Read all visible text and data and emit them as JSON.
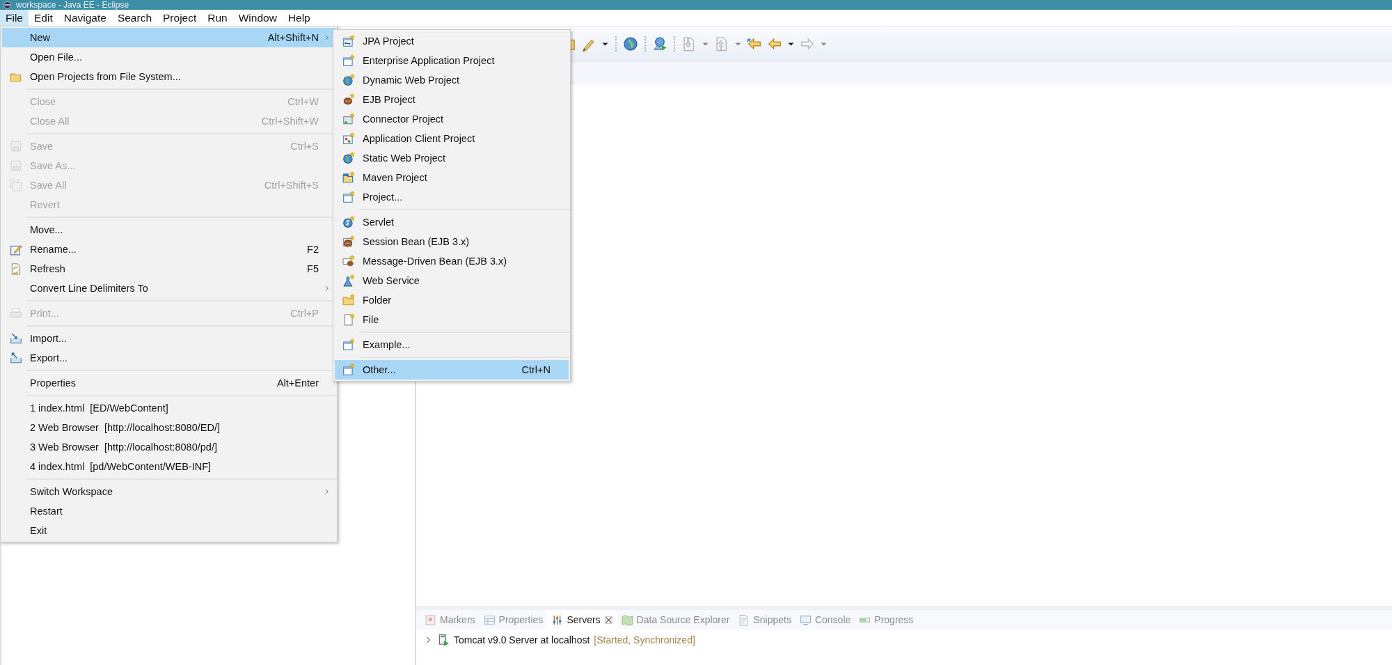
{
  "window": {
    "title": "workspace - Java EE - Eclipse"
  },
  "menu_bar": [
    {
      "label": "File",
      "selected": true
    },
    {
      "label": "Edit",
      "selected": false
    },
    {
      "label": "Navigate",
      "selected": false
    },
    {
      "label": "Search",
      "selected": false
    },
    {
      "label": "Project",
      "selected": false
    },
    {
      "label": "Run",
      "selected": false
    },
    {
      "label": "Window",
      "selected": false
    },
    {
      "label": "Help",
      "selected": false
    }
  ],
  "file_menu": {
    "items": [
      {
        "kind": "item",
        "label": "New",
        "shortcut": "Alt+Shift+N",
        "submenu": true,
        "disabled": false,
        "selected": true
      },
      {
        "kind": "item",
        "label": "Open File...",
        "submenu": false,
        "disabled": false,
        "selected": false
      },
      {
        "kind": "item",
        "label": "Open Projects from File System...",
        "submenu": false,
        "disabled": false,
        "selected": false
      },
      {
        "kind": "separator"
      },
      {
        "kind": "item",
        "label": "Close",
        "shortcut": "Ctrl+W",
        "submenu": false,
        "disabled": true,
        "selected": false
      },
      {
        "kind": "item",
        "label": "Close All",
        "shortcut": "Ctrl+Shift+W",
        "submenu": false,
        "disabled": true,
        "selected": false
      },
      {
        "kind": "separator"
      },
      {
        "kind": "item",
        "label": "Save",
        "shortcut": "Ctrl+S",
        "submenu": false,
        "disabled": true,
        "selected": false
      },
      {
        "kind": "item",
        "label": "Save As...",
        "submenu": false,
        "disabled": true,
        "selected": false
      },
      {
        "kind": "item",
        "label": "Save All",
        "shortcut": "Ctrl+Shift+S",
        "submenu": false,
        "disabled": true,
        "selected": false
      },
      {
        "kind": "item",
        "label": "Revert",
        "submenu": false,
        "disabled": true,
        "selected": false
      },
      {
        "kind": "separator"
      },
      {
        "kind": "item",
        "label": "Move...",
        "submenu": false,
        "disabled": false,
        "selected": false
      },
      {
        "kind": "item",
        "label": "Rename...",
        "shortcut": "F2",
        "submenu": false,
        "disabled": false,
        "selected": false
      },
      {
        "kind": "item",
        "label": "Refresh",
        "shortcut": "F5",
        "submenu": false,
        "disabled": false,
        "selected": false
      },
      {
        "kind": "item",
        "label": "Convert Line Delimiters To",
        "submenu": true,
        "disabled": false,
        "selected": false
      },
      {
        "kind": "separator"
      },
      {
        "kind": "item",
        "label": "Print...",
        "shortcut": "Ctrl+P",
        "submenu": false,
        "disabled": true,
        "selected": false
      },
      {
        "kind": "separator"
      },
      {
        "kind": "item",
        "label": "Import...",
        "submenu": false,
        "disabled": false,
        "selected": false
      },
      {
        "kind": "item",
        "label": "Export...",
        "submenu": false,
        "disabled": false,
        "selected": false
      },
      {
        "kind": "separator"
      },
      {
        "kind": "item",
        "label": "Properties",
        "shortcut": "Alt+Enter",
        "submenu": false,
        "disabled": false,
        "selected": false
      },
      {
        "kind": "separator"
      },
      {
        "kind": "item",
        "label": "1 index.html  [ED/WebContent]",
        "submenu": false,
        "disabled": false,
        "selected": false
      },
      {
        "kind": "item",
        "label": "2 Web Browser  [http://localhost:8080/ED/]",
        "submenu": false,
        "disabled": false,
        "selected": false
      },
      {
        "kind": "item",
        "label": "3 Web Browser  [http://localhost:8080/pd/]",
        "submenu": false,
        "disabled": false,
        "selected": false
      },
      {
        "kind": "item",
        "label": "4 index.html  [pd/WebContent/WEB-INF]",
        "submenu": false,
        "disabled": false,
        "selected": false
      },
      {
        "kind": "separator"
      },
      {
        "kind": "item",
        "label": "Switch Workspace",
        "submenu": true,
        "disabled": false,
        "selected": false
      },
      {
        "kind": "item",
        "label": "Restart",
        "submenu": false,
        "disabled": false,
        "selected": false
      },
      {
        "kind": "item",
        "label": "Exit",
        "submenu": false,
        "disabled": false,
        "selected": false
      }
    ]
  },
  "new_submenu": {
    "items": [
      {
        "kind": "item",
        "label": "JPA Project",
        "selected": false
      },
      {
        "kind": "item",
        "label": "Enterprise Application Project",
        "selected": false
      },
      {
        "kind": "item",
        "label": "Dynamic Web Project",
        "selected": false
      },
      {
        "kind": "item",
        "label": "EJB Project",
        "selected": false
      },
      {
        "kind": "item",
        "label": "Connector Project",
        "selected": false
      },
      {
        "kind": "item",
        "label": "Application Client Project",
        "selected": false
      },
      {
        "kind": "item",
        "label": "Static Web Project",
        "selected": false
      },
      {
        "kind": "item",
        "label": "Maven Project",
        "selected": false
      },
      {
        "kind": "item",
        "label": "Project...",
        "selected": false
      },
      {
        "kind": "separator"
      },
      {
        "kind": "item",
        "label": "Servlet",
        "selected": false
      },
      {
        "kind": "item",
        "label": "Session Bean (EJB 3.x)",
        "selected": false
      },
      {
        "kind": "item",
        "label": "Message-Driven Bean (EJB 3.x)",
        "selected": false
      },
      {
        "kind": "item",
        "label": "Web Service",
        "selected": false
      },
      {
        "kind": "item",
        "label": "Folder",
        "selected": false
      },
      {
        "kind": "item",
        "label": "File",
        "selected": false
      },
      {
        "kind": "separator"
      },
      {
        "kind": "item",
        "label": "Example...",
        "selected": false
      },
      {
        "kind": "separator"
      },
      {
        "kind": "item",
        "label": "Other...",
        "shortcut": "Ctrl+N",
        "selected": true
      }
    ]
  },
  "bottom_panel": {
    "tabs": [
      {
        "label": "Markers",
        "selected": false
      },
      {
        "label": "Properties",
        "selected": false
      },
      {
        "label": "Servers",
        "selected": true
      },
      {
        "label": "Data Source Explorer",
        "selected": false
      },
      {
        "label": "Snippets",
        "selected": false
      },
      {
        "label": "Console",
        "selected": false
      },
      {
        "label": "Progress",
        "selected": false
      }
    ],
    "servers": [
      {
        "label": "Tomcat v9.0 Server at localhost",
        "status": "[Started, Synchronized]",
        "expanded": false
      }
    ]
  }
}
